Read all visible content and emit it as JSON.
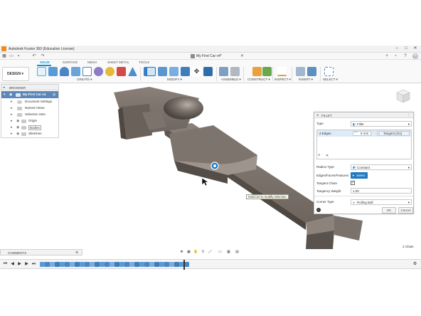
{
  "window": {
    "title": "Autodesk Fusion 360 (Education License)",
    "controls": [
      "–",
      "□",
      "✕"
    ]
  },
  "quickaccess": {
    "icons": [
      "grid-icon",
      "file-icon",
      "save-icon",
      "undo-icon",
      "redo-icon"
    ],
    "doc_title": "My First Car v4*",
    "user_initials": "CC"
  },
  "ribbon": {
    "tabs": [
      "SOLID",
      "SURFACE",
      "MESH",
      "SHEET METAL",
      "TOOLS"
    ],
    "active_tab": "SOLID",
    "design_label": "DESIGN ▾",
    "groups": [
      "CREATE ▾",
      "MODIFY ▾",
      "ASSEMBLE ▾",
      "CONSTRUCT ▾",
      "INSPECT ▾",
      "INSERT ▾",
      "SELECT ▾"
    ]
  },
  "browser": {
    "title": "BROWSER",
    "root": "My First Car v4",
    "items": [
      "Document Settings",
      "Named Views",
      "Selection Sets",
      "Origin",
      "Bodies",
      "Sketches"
    ]
  },
  "fillet": {
    "title": "FILLET",
    "type_label": "Type",
    "type_value": "Fillet",
    "edges_label": "4 Edges",
    "edges_radius": "5 mm",
    "edges_continuity": "Tangent (G1)",
    "add": "+",
    "remove": "✕",
    "radius_type_label": "Radius Type",
    "radius_type_value": "Constant",
    "edges_faces_label": "Edges/Faces/Features",
    "select_label": "Select",
    "tangent_chain_label": "Tangent Chain",
    "tangency_weight_label": "Tangency Weight",
    "tangency_weight_value": "1.00",
    "corner_type_label": "Corner Type",
    "corner_type_value": "Rolling Ball",
    "ok": "OK",
    "cancel": "Cancel"
  },
  "viewport": {
    "tooltip": "Hold Ctrl to modify selection",
    "status_right": "2 Chain"
  },
  "comments": {
    "label": "COMMENTS"
  },
  "timeline": {
    "controls": [
      "⏮",
      "◀",
      "▶",
      "▶",
      "⏭"
    ],
    "feature_count": 30
  },
  "colors": {
    "accent": "#0696d7",
    "model": "#6b625b",
    "browser_root": "#5b87b8"
  }
}
